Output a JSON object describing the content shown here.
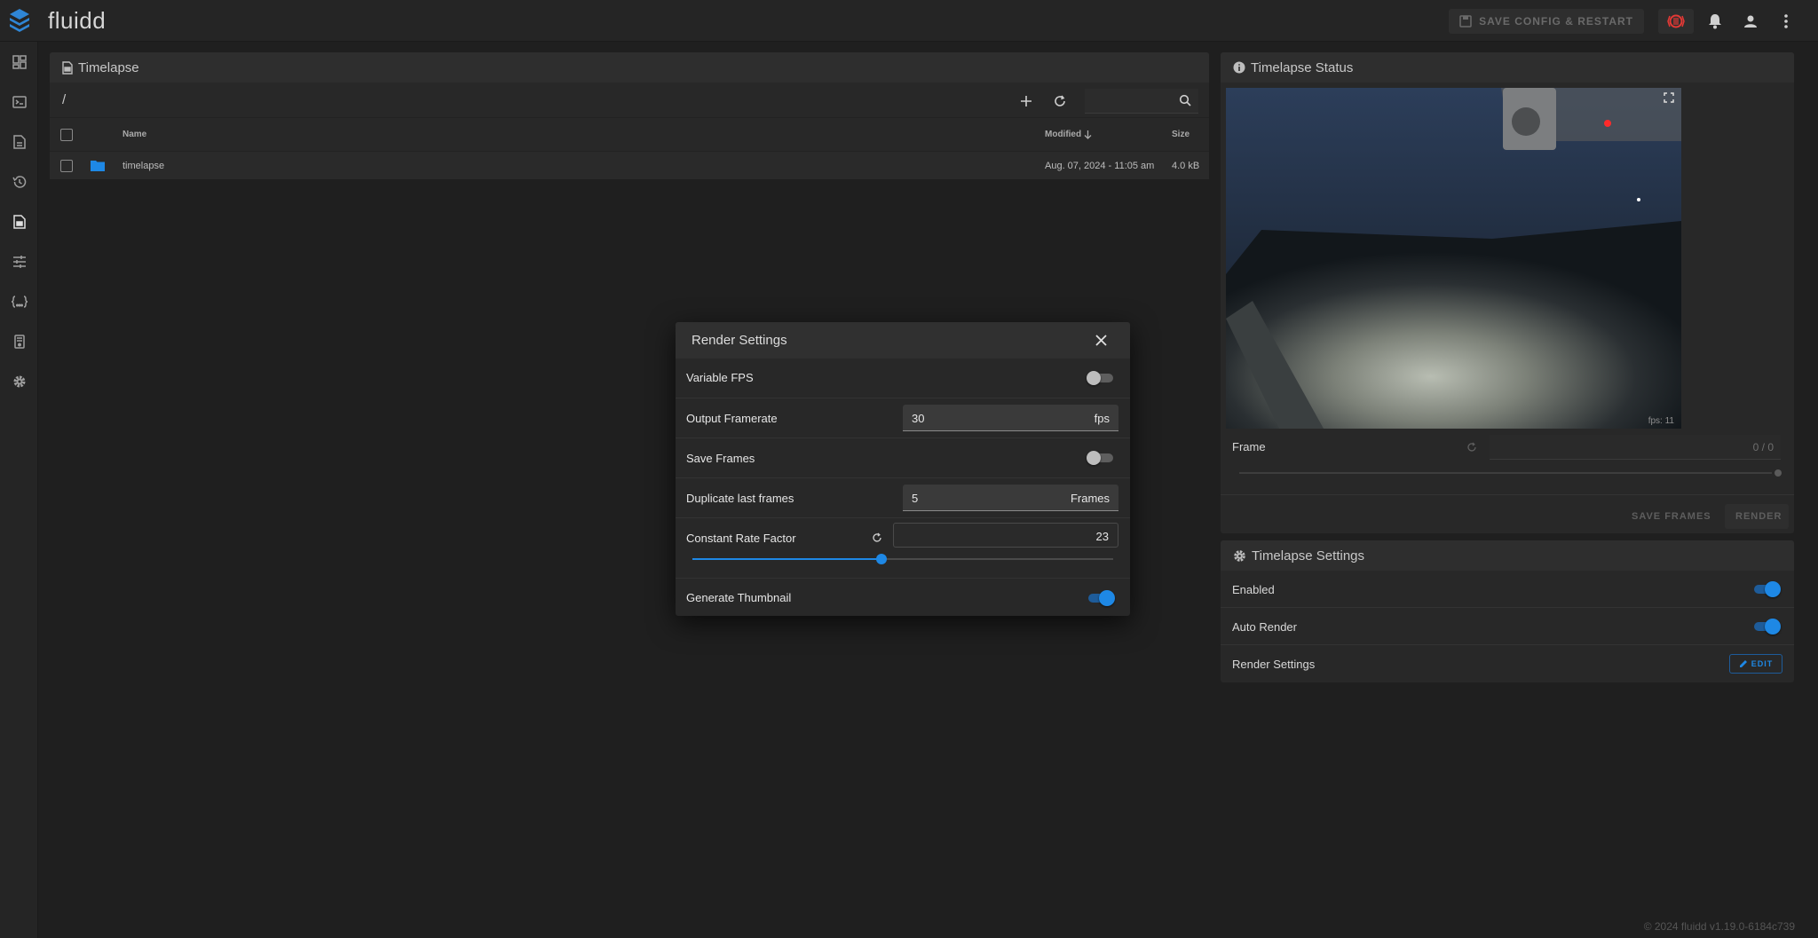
{
  "app": {
    "brand": "fluidd"
  },
  "appbar": {
    "save_config_label": "SAVE CONFIG & RESTART",
    "icons": [
      "emergency-stop-icon",
      "bell-icon",
      "account-icon",
      "more-vert-icon"
    ]
  },
  "sidebar": {
    "items": [
      "dashboard-icon",
      "console-icon",
      "jobs-icon",
      "history-icon",
      "timelapse-icon",
      "tune-icon",
      "macros-icon",
      "system-icon",
      "settings-icon"
    ]
  },
  "files": {
    "title": "Timelapse",
    "path": "/",
    "search_placeholder": "",
    "columns": {
      "name": "Name",
      "modified": "Modified",
      "size": "Size"
    },
    "rows": [
      {
        "name": "timelapse",
        "modified": "Aug. 07, 2024 - 11:05 am",
        "size": "4.0 kB"
      }
    ]
  },
  "status": {
    "title": "Timelapse Status",
    "fps": "fps: 11",
    "frame_label": "Frame",
    "frame_value": "0 / 0",
    "save_frames_label": "SAVE FRAMES",
    "render_label": "RENDER"
  },
  "settings": {
    "title": "Timelapse Settings",
    "enabled_label": "Enabled",
    "enabled": true,
    "auto_render_label": "Auto Render",
    "auto_render": true,
    "render_settings_label": "Render Settings",
    "edit_label": "EDIT"
  },
  "modal": {
    "title": "Render Settings",
    "variable_fps_label": "Variable FPS",
    "variable_fps": false,
    "output_framerate_label": "Output Framerate",
    "output_framerate": "30",
    "output_framerate_unit": "fps",
    "save_frames_label": "Save Frames",
    "save_frames": false,
    "duplicate_label": "Duplicate last frames",
    "duplicate_value": "5",
    "duplicate_unit": "Frames",
    "crf_label": "Constant Rate Factor",
    "crf_value": "23",
    "crf_slider_fraction": 0.45,
    "thumbnail_label": "Generate Thumbnail",
    "thumbnail": true
  },
  "footer": {
    "text": "© 2024 fluidd v1.19.0-6184c739"
  },
  "colors": {
    "accent": "#1e88e5",
    "background": "#1f1f1f",
    "card": "#282828"
  }
}
